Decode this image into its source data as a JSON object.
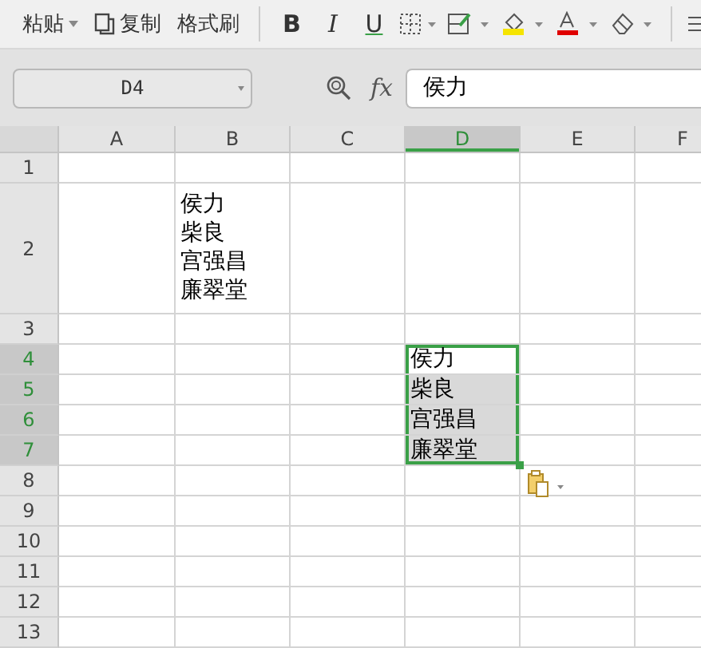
{
  "toolbar": [
    {
      "kind": "dropdown",
      "label": "粘贴"
    },
    {
      "kind": "icon-label",
      "label": "复制"
    },
    {
      "kind": "label",
      "label": "格式刷"
    },
    {
      "kind": "bold",
      "label": "B"
    },
    {
      "kind": "italic",
      "label": "I"
    },
    {
      "kind": "underline",
      "label": "U"
    }
  ],
  "name_box": {
    "value": "D4"
  },
  "formula": {
    "function_label": "fx",
    "value": "侯力"
  },
  "columns": [
    {
      "label": "A",
      "selected": false
    },
    {
      "label": "B",
      "selected": false
    },
    {
      "label": "C",
      "selected": false
    },
    {
      "label": "D",
      "selected": true
    },
    {
      "label": "E",
      "selected": false
    },
    {
      "label": "F",
      "selected": false
    }
  ],
  "rows": [
    {
      "label": "1",
      "selected": false
    },
    {
      "label": "2",
      "selected": false,
      "column_b": {
        "lines": [
          "侯力",
          "柴良",
          "宫强昌",
          "廉翠堂"
        ],
        "selected": false
      }
    },
    {
      "label": "3",
      "selected": false
    },
    {
      "label": "4",
      "selected": true,
      "column_d": {
        "lines": [
          "侯力"
        ],
        "selected": true
      }
    },
    {
      "label": "5",
      "selected": true,
      "column_d": {
        "lines": [
          "柴良"
        ],
        "selected": true
      }
    },
    {
      "label": "6",
      "selected": true,
      "column_d": {
        "lines": [
          "宫强昌"
        ],
        "selected": true
      }
    },
    {
      "label": "7",
      "selected": true,
      "column_d": {
        "lines": [
          "廉翠堂"
        ],
        "selected": true
      }
    },
    {
      "label": "8",
      "selected": false
    },
    {
      "label": "9",
      "selected": false
    },
    {
      "label": "10",
      "selected": false
    },
    {
      "label": "11",
      "selected": false
    },
    {
      "label": "12",
      "selected": false
    },
    {
      "label": "13",
      "selected": false
    }
  ]
}
